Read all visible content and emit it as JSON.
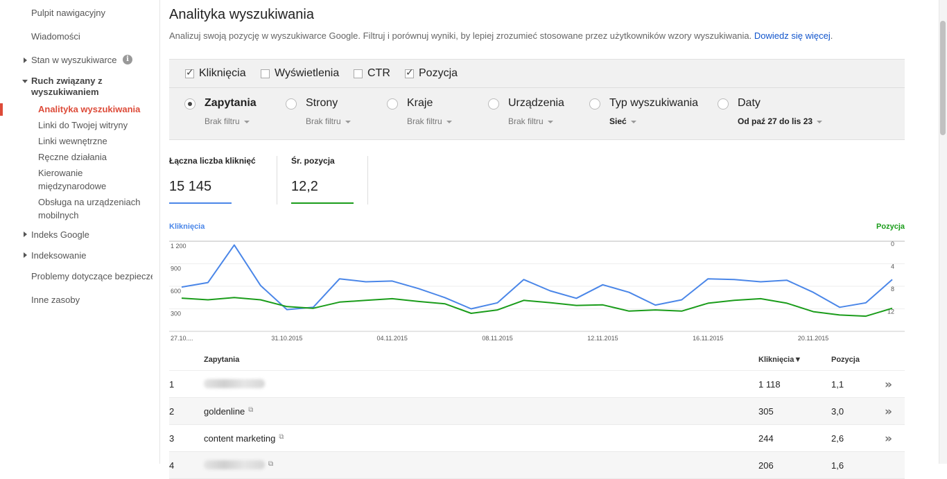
{
  "sidebar": {
    "items": [
      {
        "label": "Pulpit nawigacyjny"
      },
      {
        "label": "Wiadomości"
      },
      {
        "label": "Stan w wyszukiwarce"
      },
      {
        "label": "Ruch związany z wyszukiwaniem"
      },
      {
        "label": "Indeks Google"
      },
      {
        "label": "Indeksowanie"
      },
      {
        "label": "Problemy dotyczące bezpieczeństwa"
      },
      {
        "label": "Inne zasoby"
      }
    ],
    "subitems": [
      {
        "label": "Analityka wyszukiwania",
        "active": true
      },
      {
        "label": "Linki do Twojej witryny"
      },
      {
        "label": "Linki wewnętrzne"
      },
      {
        "label": "Ręczne działania"
      },
      {
        "label": "Kierowanie międzynarodowe"
      },
      {
        "label": "Obsługa na urządzeniach mobilnych"
      }
    ],
    "ruch_line1": "Ruch związany z",
    "ruch_line2": "wyszukiwaniem",
    "kier_line1": "Kierowanie",
    "kier_line2": "międzynarodowe",
    "obs_line1": "Obsługa na urządzeniach",
    "obs_line2": "mobilnych",
    "active_color": "#dd4b39"
  },
  "page": {
    "title": "Analityka wyszukiwania",
    "description": "Analizuj swoją pozycję w wyszukiwarce Google. Filtruj i porównuj wyniki, by lepiej zrozumieć stosowane przez użytkowników wzory wyszukiwania.",
    "learn_more": "Dowiedz się więcej",
    "period": "."
  },
  "metrics": [
    {
      "label": "Kliknięcia",
      "checked": true
    },
    {
      "label": "Wyświetlenia",
      "checked": false
    },
    {
      "label": "CTR",
      "checked": false
    },
    {
      "label": "Pozycja",
      "checked": true
    }
  ],
  "dimensions": [
    {
      "label": "Zapytania",
      "filter": "Brak filtru",
      "selected": true
    },
    {
      "label": "Strony",
      "filter": "Brak filtru",
      "selected": false
    },
    {
      "label": "Kraje",
      "filter": "Brak filtru",
      "selected": false
    },
    {
      "label": "Urządzenia",
      "filter": "Brak filtru",
      "selected": false
    },
    {
      "label": "Typ wyszukiwania",
      "filter": "Sieć",
      "selected": false
    },
    {
      "label": "Daty",
      "filter": "Od paź 27 do lis 23",
      "selected": false
    }
  ],
  "stats": [
    {
      "label": "Łączna liczba kliknięć",
      "value": "15 145",
      "color": "#4a86e8"
    },
    {
      "label": "Śr. pozycja",
      "value": "12,2",
      "color": "#1a9c1a"
    }
  ],
  "chart_data": {
    "type": "line",
    "x": [
      "27.10....",
      "28.10",
      "29.10",
      "30.10",
      "31.10.2015",
      "01.11",
      "02.11",
      "03.11",
      "04.11.2015",
      "05.11",
      "06.11",
      "07.11",
      "08.11.2015",
      "09.11",
      "10.11",
      "11.11",
      "12.11.2015",
      "13.11",
      "14.11",
      "15.11",
      "16.11.2015",
      "17.11",
      "18.11",
      "19.11",
      "20.11.2015",
      "21.11",
      "22.11",
      "23.11"
    ],
    "x_ticks": [
      "27.10....",
      "31.10.2015",
      "04.11.2015",
      "08.11.2015",
      "12.11.2015",
      "16.11.2015",
      "20.11.2015"
    ],
    "left_axis": {
      "label": "Kliknięcia",
      "ticks": [
        "1 200",
        "900",
        "600",
        "300"
      ],
      "range": [
        0,
        1200
      ]
    },
    "right_axis": {
      "label": "Pozycja",
      "ticks": [
        "0",
        "4",
        "8",
        "12"
      ],
      "range": [
        0,
        16
      ],
      "inverted": true
    },
    "series": [
      {
        "name": "Kliknięcia",
        "axis": "left",
        "color": "#4a86e8",
        "values": [
          590,
          650,
          1150,
          610,
          290,
          320,
          700,
          660,
          670,
          570,
          450,
          300,
          380,
          690,
          540,
          440,
          620,
          520,
          350,
          420,
          700,
          690,
          660,
          680,
          520,
          320,
          380,
          690
        ]
      },
      {
        "name": "Pozycja",
        "axis": "right",
        "color": "#1a9c1a",
        "values": [
          10.1,
          10.4,
          10.0,
          10.4,
          11.6,
          11.9,
          10.8,
          10.5,
          10.2,
          10.7,
          11.1,
          12.8,
          12.2,
          10.5,
          10.9,
          11.4,
          11.3,
          12.4,
          12.2,
          12.4,
          11.0,
          10.5,
          10.2,
          11.0,
          12.5,
          13.1,
          13.3,
          11.9
        ]
      }
    ]
  },
  "table": {
    "headers": {
      "query": "Zapytania",
      "clicks": "Kliknięcia▼",
      "position": "Pozycja"
    },
    "rows": [
      {
        "num": "1",
        "query": "",
        "clicks": "1 118",
        "position": "1,1"
      },
      {
        "num": "2",
        "query": "goldenline",
        "clicks": "305",
        "position": "3,0"
      },
      {
        "num": "3",
        "query": "content marketing",
        "clicks": "244",
        "position": "2,6"
      },
      {
        "num": "4",
        "query": "",
        "clicks": "206",
        "position": "1,6"
      }
    ]
  }
}
